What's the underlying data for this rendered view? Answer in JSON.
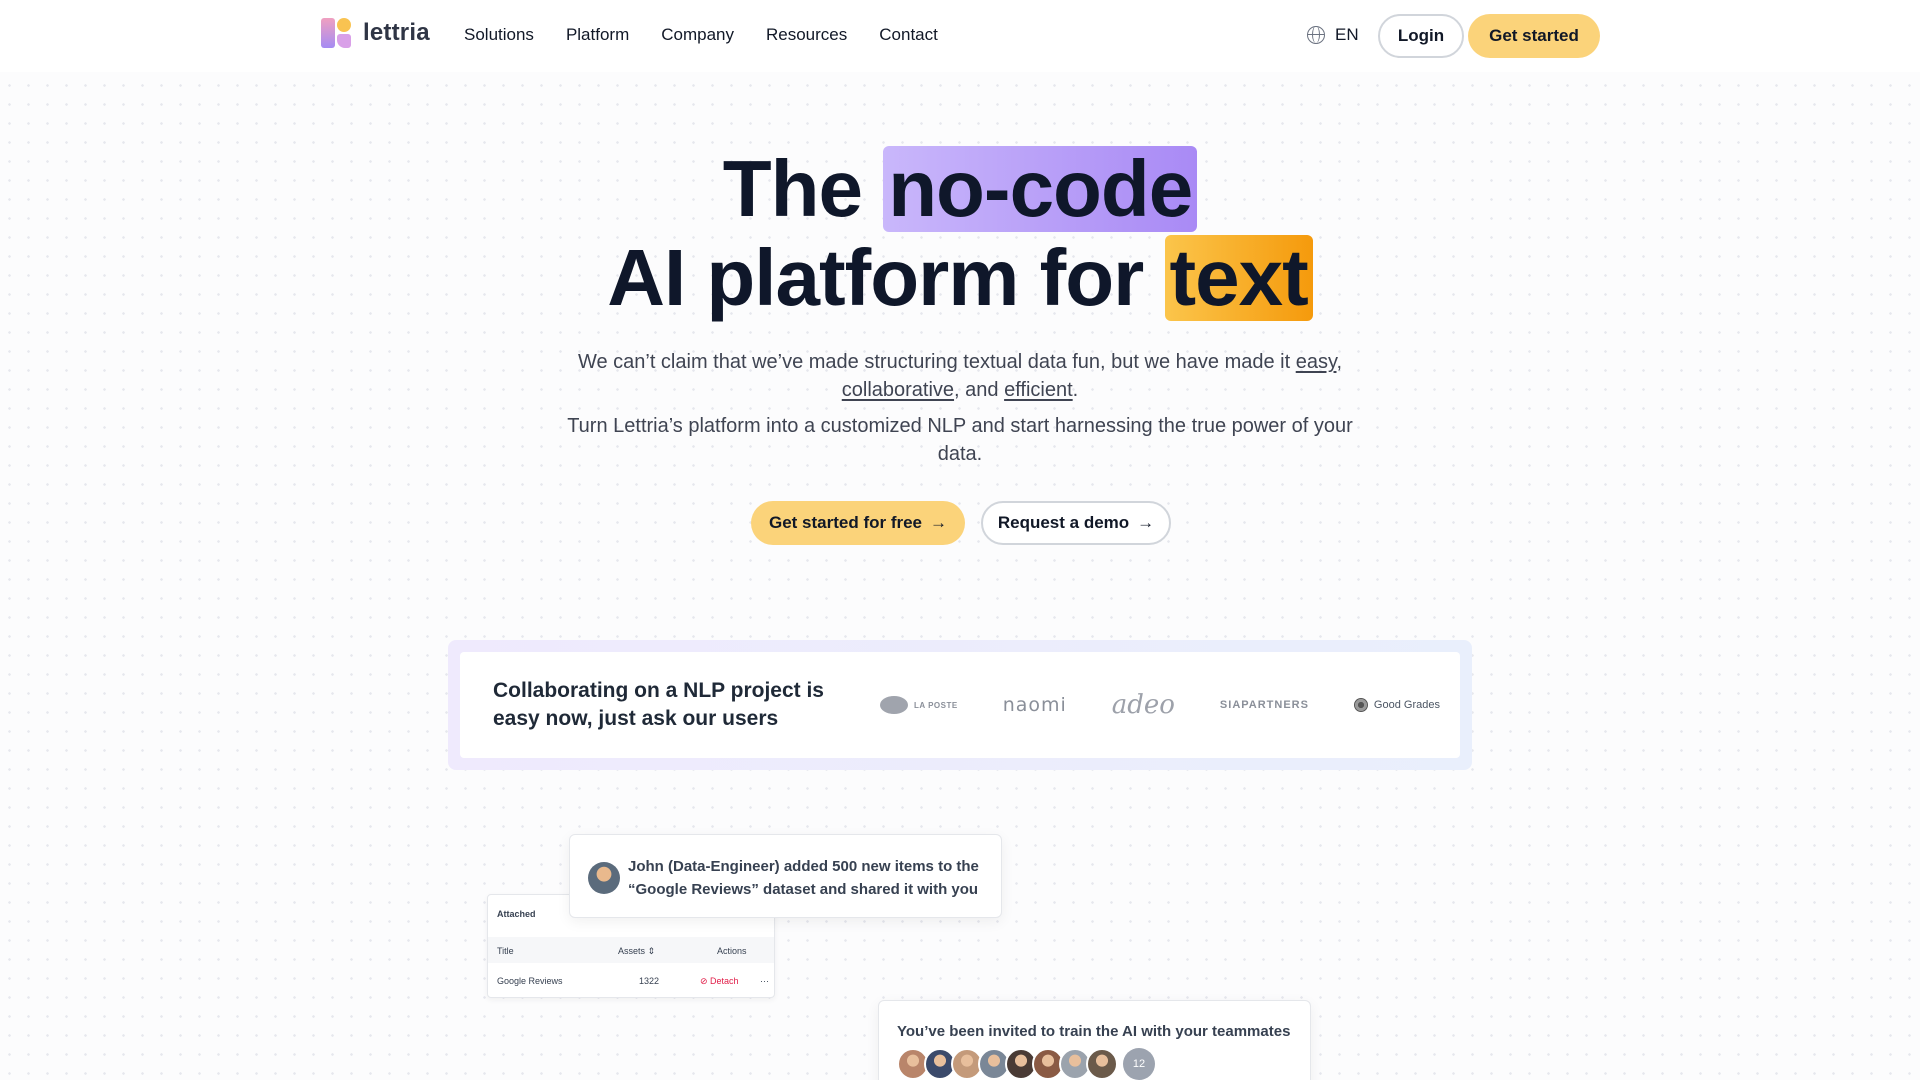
{
  "nav": {
    "logo_text": "lettria",
    "menu": [
      "Solutions",
      "Platform",
      "Company",
      "Resources",
      "Contact"
    ],
    "language": "EN",
    "login": "Login",
    "get_started": "Get started"
  },
  "hero": {
    "line1_prefix": "The",
    "line1_highlight": "no-code",
    "line2_prefix": "AI platform for",
    "line2_highlight": "text",
    "sub1_part1": "We can’t claim that we’ve made structuring textual data fun, but we have made it",
    "sub1_link1": "easy",
    "sub1_link2": "collaborative",
    "sub1_and": ", and",
    "sub1_link3": "efficient",
    "sub2": "Turn Lettria’s platform into a customized NLP and start harnessing the true power of your data.",
    "cta_primary": "Get started for free",
    "cta_secondary": "Request a demo",
    "arrow": "→"
  },
  "users": {
    "text": "Collaborating on a NLP project is easy now, just ask our users",
    "logos": {
      "laposte": "LA POSTE",
      "naomi": "naomi",
      "adeo": "adeo",
      "sia": "SIAPARTNERS",
      "gg": "Good Grades"
    }
  },
  "attached": {
    "title": "Attached",
    "col_title": "Title",
    "col_assets": "Assets ⇕",
    "col_actions": "Actions",
    "row_title": "Google Reviews",
    "row_assets": "1322",
    "row_action": "⊘ Detach",
    "row_more": "···"
  },
  "notification": {
    "text": "John (Data-Engineer) added 500 new items to the “Google Reviews” dataset and shared it with you"
  },
  "invite": {
    "text": "You’ve been invited to train the AI with your teammates",
    "count": "12",
    "avatar_colors": [
      "#b9856a",
      "#3b4a6b",
      "#c49a7a",
      "#7a8797",
      "#4a3b35",
      "#8a5a44",
      "#9ba3ad",
      "#6b5a4a"
    ]
  },
  "colors": {
    "accent_yellow": "#fbd37a",
    "highlight_purple": "#b9a1f8",
    "highlight_orange": "#f8b02b"
  }
}
